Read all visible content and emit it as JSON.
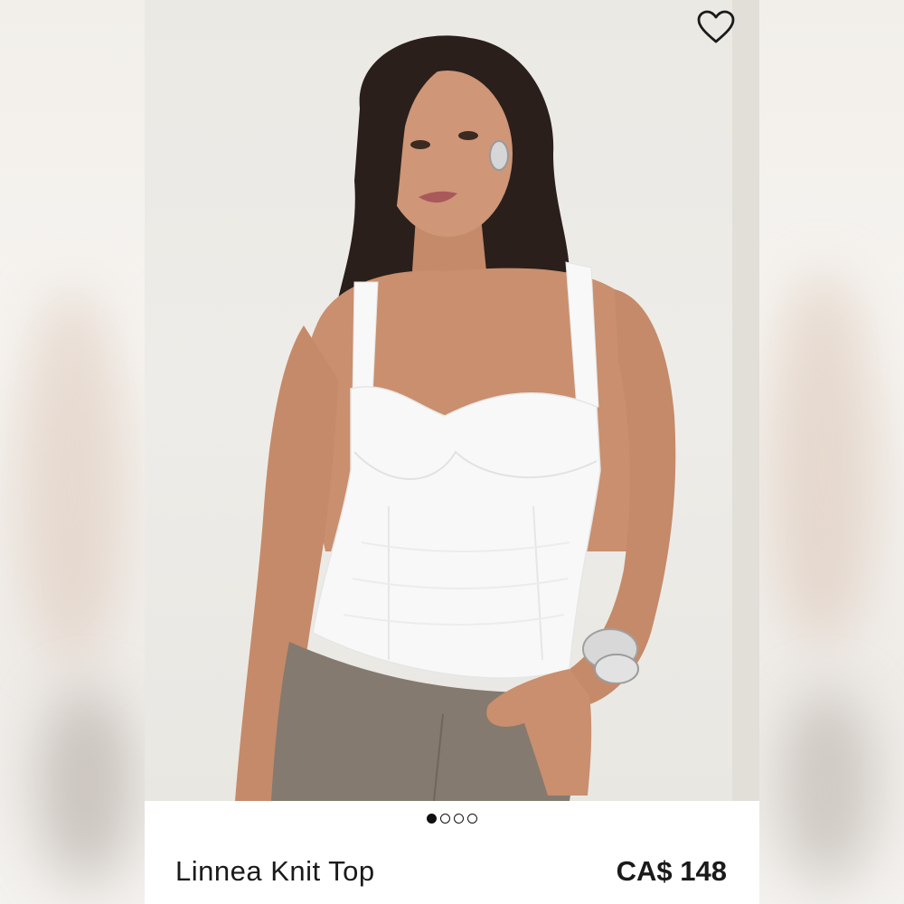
{
  "product": {
    "name": "Linnea Knit Top",
    "price": "CA$ 148"
  },
  "gallery": {
    "total_images": 4,
    "active_index": 1
  },
  "icons": {
    "wishlist": "heart-outline-icon"
  },
  "colors": {
    "text": "#1a1a1a",
    "background": "#ffffff",
    "photo_background": "#ebe9e4",
    "top_garment": "#f8f8f8",
    "trousers": "#847a6f",
    "hair": "#2a1f1b",
    "skin": "#c9906f"
  }
}
